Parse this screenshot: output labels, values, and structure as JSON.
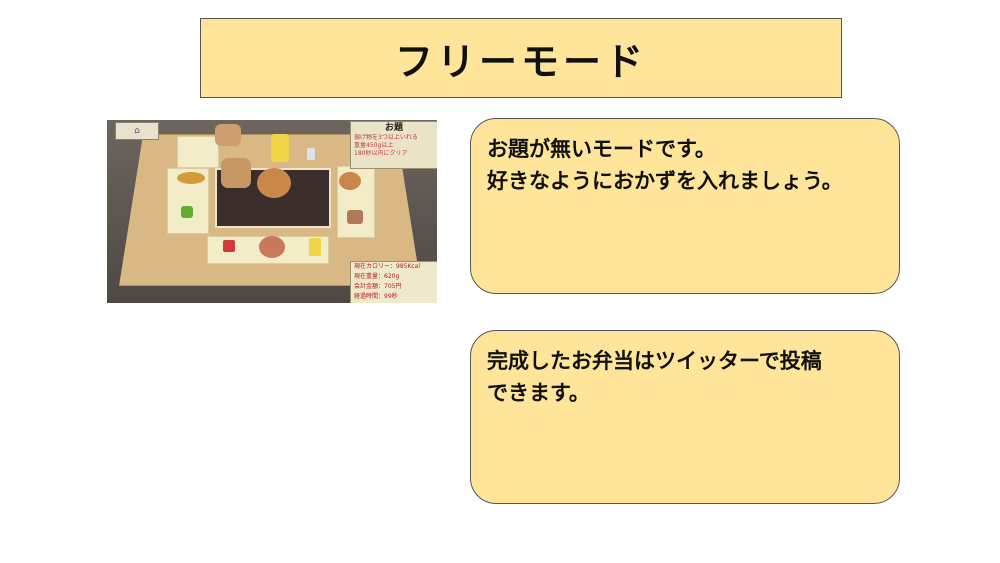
{
  "title": "フリーモード",
  "card1": {
    "lines": [
      "お題が無いモードです。",
      "好きなようにおかずを入れましょう。"
    ]
  },
  "card2": {
    "lines": [
      "完成したお弁当はツイッターで投稿",
      "できます。"
    ]
  },
  "game_screenshot": {
    "task_title": "お題",
    "task_lines": [
      "揚げ物を3つ以上いれる",
      "重量450g以上",
      "180秒以内にクリア"
    ],
    "stats": [
      "現在カロリー：985Kcal",
      "現在重量：620g",
      "会計金額：705円",
      "経過時間：99秒"
    ],
    "colors": {
      "board": "#d9b886",
      "tray": "#f3ecc8",
      "panel": "#e9e3c8",
      "accent_text": "#c03a3a"
    }
  }
}
